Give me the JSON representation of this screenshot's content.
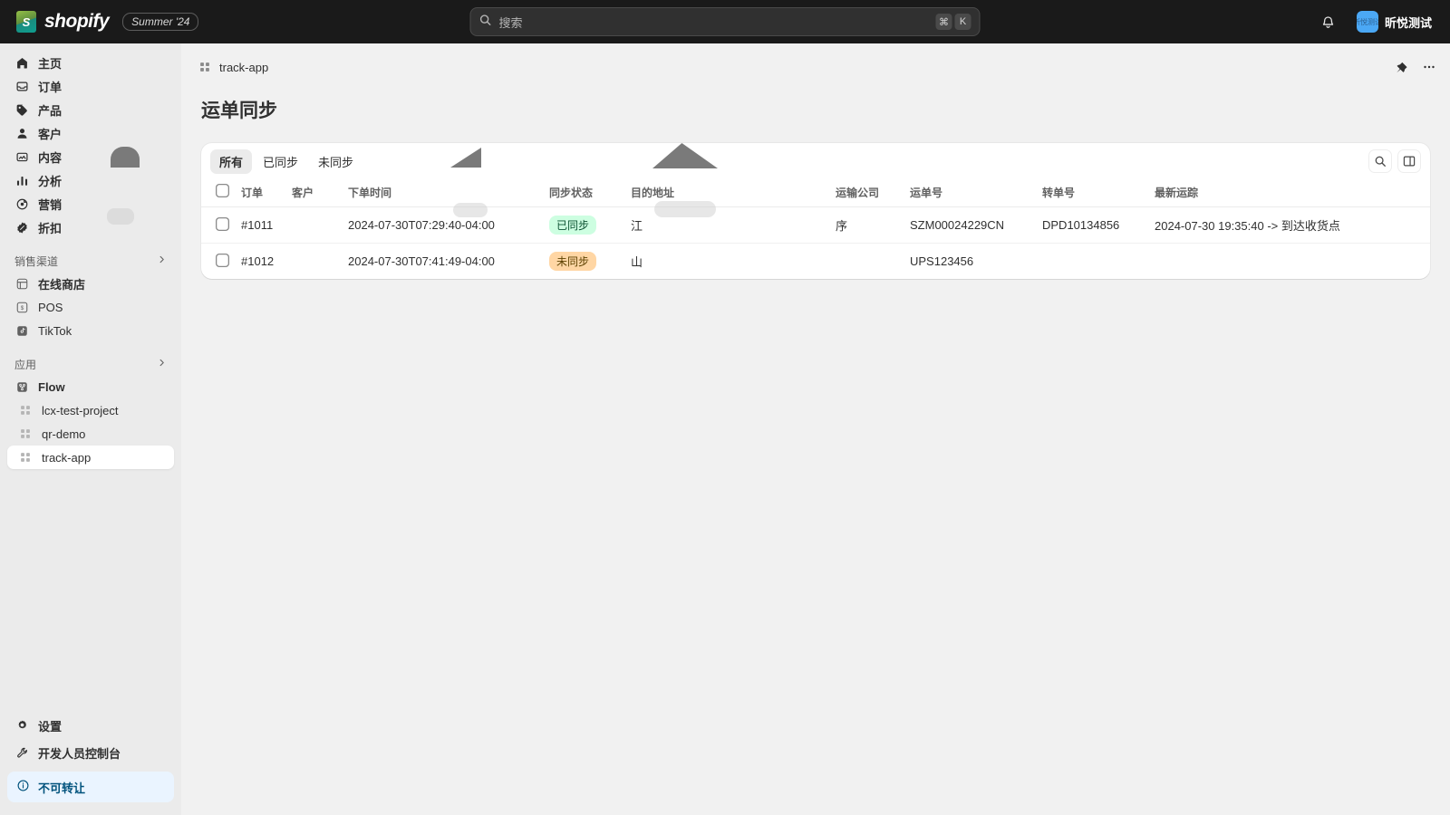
{
  "topbar": {
    "brand_mark": "S",
    "brand_name": "shopify",
    "release_badge": "Summer '24",
    "search": {
      "placeholder": "搜索",
      "kbd1": "⌘",
      "kbd2": "K",
      "icon": "search-icon"
    },
    "notifications_icon": "bell-icon",
    "user": {
      "avatar_text": "昕悦测试",
      "name": "昕悦测试"
    }
  },
  "sidebar": {
    "primary": [
      {
        "label": "主页",
        "icon": "home-icon"
      },
      {
        "label": "订单",
        "icon": "orders-icon"
      },
      {
        "label": "产品",
        "icon": "products-icon"
      },
      {
        "label": "客户",
        "icon": "customers-icon"
      },
      {
        "label": "内容",
        "icon": "content-icon"
      },
      {
        "label": "分析",
        "icon": "analytics-icon"
      },
      {
        "label": "营销",
        "icon": "marketing-icon"
      },
      {
        "label": "折扣",
        "icon": "discounts-icon"
      }
    ],
    "channels_section": {
      "label": "销售渠道",
      "chevron": "chevron-right-icon"
    },
    "channels": [
      {
        "label": "在线商店",
        "icon": "online-store-icon"
      },
      {
        "label": "POS",
        "icon": "pos-icon"
      },
      {
        "label": "TikTok",
        "icon": "tiktok-icon"
      }
    ],
    "apps_section": {
      "label": "应用",
      "chevron": "chevron-right-icon"
    },
    "apps": [
      {
        "label": "Flow",
        "icon": "flow-icon"
      },
      {
        "label": "lcx-test-project",
        "icon": "app-icon"
      },
      {
        "label": "qr-demo",
        "icon": "app-icon"
      },
      {
        "label": "track-app",
        "icon": "app-icon"
      }
    ],
    "bottom": [
      {
        "label": "设置",
        "icon": "gear-icon"
      },
      {
        "label": "开发人员控制台",
        "icon": "wrench-icon"
      }
    ],
    "notice": {
      "label": "不可转让",
      "icon": "info-icon"
    }
  },
  "breadcrumb": {
    "app_name": "track-app",
    "app_icon": "app-icon",
    "pin_icon": "pin-icon",
    "more_icon": "ellipsis-icon"
  },
  "page": {
    "title": "运单同步"
  },
  "card": {
    "tabs": [
      {
        "label": "所有"
      },
      {
        "label": "已同步"
      },
      {
        "label": "未同步"
      }
    ],
    "active_tab_index": 0,
    "actions": [
      {
        "icon": "search-icon"
      },
      {
        "icon": "columns-icon"
      }
    ],
    "columns": [
      "订单",
      "客户",
      "下单时间",
      "同步状态",
      "目的地址",
      "运输公司",
      "运单号",
      "转单号",
      "最新运踪"
    ],
    "rows": [
      {
        "order": "#1011",
        "customer": "",
        "order_time": "2024-07-30T07:29:40-04:00",
        "sync_status": "已同步",
        "sync_status_tone": "green",
        "destination": "江",
        "carrier": "序",
        "tracking_no": "SZM00024229CN",
        "transfer_no": "DPD10134856",
        "latest_tracking": "2024-07-30 19:35:40 -> 到达收货点"
      },
      {
        "order": "#1012",
        "customer": "",
        "order_time": "2024-07-30T07:41:49-04:00",
        "sync_status": "未同步",
        "sync_status_tone": "orange",
        "destination": "山",
        "carrier": "",
        "tracking_no": "UPS123456",
        "transfer_no": "",
        "latest_tracking": ""
      }
    ]
  },
  "colors": {
    "topbar_bg": "#1a1a1a",
    "sidebar_bg": "#ebebeb",
    "canvas_bg": "#f1f1f1",
    "accent_blue": "#4ba8f5",
    "badge_green_bg": "#cdfee1",
    "badge_orange_bg": "#ffd6a4",
    "notice_bg": "#eaf4ff"
  }
}
